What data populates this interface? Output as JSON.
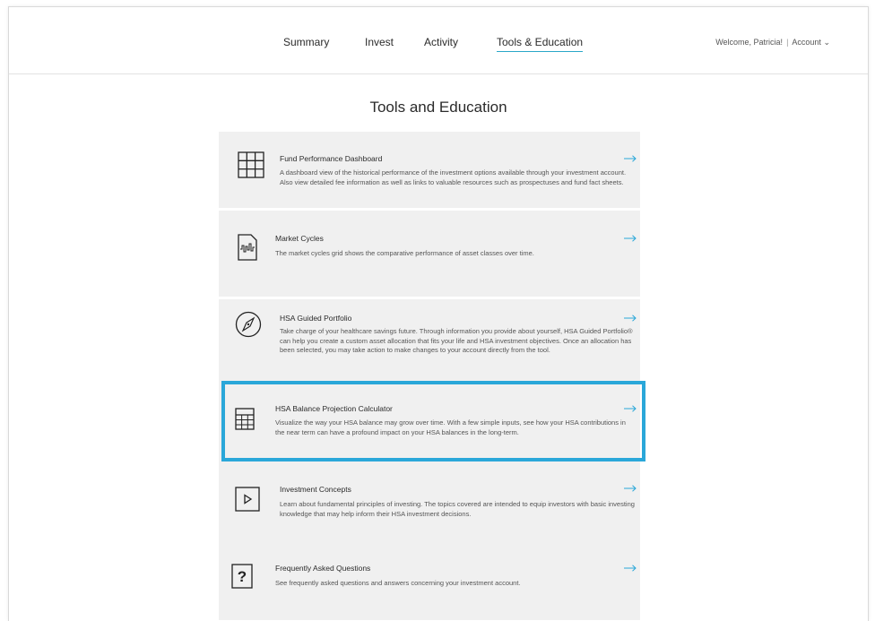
{
  "nav": {
    "items": [
      {
        "label": "Summary"
      },
      {
        "label": "Invest"
      },
      {
        "label": "Activity"
      },
      {
        "label": "Tools & Education",
        "active": true
      }
    ],
    "welcome": "Welcome, Patricia!",
    "account_label": "Account",
    "account_caret": "⌄"
  },
  "page": {
    "title": "Tools and Education"
  },
  "tools": [
    {
      "title": "Fund Performance Dashboard",
      "icon": "grid-icon",
      "description": "A dashboard view of the historical performance of the investment options available through your investment account. Also view detailed fee information as well as links to valuable resources such as prospectuses and fund fact sheets."
    },
    {
      "title": "Market Cycles",
      "icon": "market-cycles-icon",
      "description": "The market cycles grid shows the comparative performance of asset classes over time."
    },
    {
      "title": "HSA Guided Portfolio",
      "icon": "compass-icon",
      "description": "Take charge of your healthcare savings future. Through information you provide about yourself, HSA Guided Portfolio® can help you create a custom asset allocation that fits your life and HSA investment objectives. Once an allocation has been selected, you may take action to make changes to your account directly from the tool."
    },
    {
      "title": "HSA Balance Projection Calculator",
      "icon": "calculator-icon",
      "description": "Visualize the way your HSA balance may grow over time. With a few simple inputs, see how your HSA contributions in the near term can have a profound impact on your HSA balances in the long-term."
    },
    {
      "title": "Investment Concepts",
      "icon": "play-icon",
      "description": "Learn about fundamental principles of investing. The topics covered are intended to equip investors with basic investing knowledge that may help inform their HSA investment decisions."
    },
    {
      "title": "Frequently Asked Questions",
      "icon": "question-icon",
      "description": "See frequently asked questions and answers concerning your investment account."
    }
  ],
  "colors": {
    "accent": "#2aa7d9",
    "panel": "#f0f0f0",
    "text": "#2b2b2b"
  }
}
